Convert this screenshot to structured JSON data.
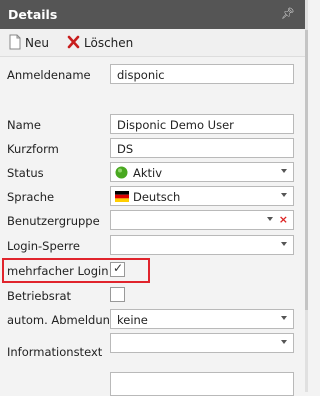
{
  "panel": {
    "title": "Details",
    "pin_icon": "pin-icon"
  },
  "toolbar": {
    "new_label": "Neu",
    "delete_label": "Löschen"
  },
  "fields": {
    "anmeldename": {
      "label": "Anmeldename",
      "value": "disponic"
    },
    "name": {
      "label": "Name",
      "value": "Disponic Demo User"
    },
    "kurzform": {
      "label": "Kurzform",
      "value": "DS"
    },
    "status": {
      "label": "Status",
      "value": "Aktiv",
      "status_color": "#49a820"
    },
    "sprache": {
      "label": "Sprache",
      "value": "Deutsch",
      "flag_colors": [
        "#000000",
        "#dd0000",
        "#ffce00"
      ]
    },
    "benutzergruppe": {
      "label": "Benutzergruppe",
      "value": ""
    },
    "login_sperre": {
      "label": "Login-Sperre",
      "value": ""
    },
    "mehrfacher_login": {
      "label": "mehrfacher Login",
      "checked": true
    },
    "betriebsrat": {
      "label": "Betriebsrat",
      "checked": false
    },
    "autom_abmeldung": {
      "label": "autom. Abmeldung",
      "value": "keine"
    },
    "informationstext": {
      "label": "Informationstext",
      "value": ""
    }
  },
  "colors": {
    "header_bg": "#555555",
    "highlight": "#e0242c",
    "delete_icon": "#d22222"
  }
}
